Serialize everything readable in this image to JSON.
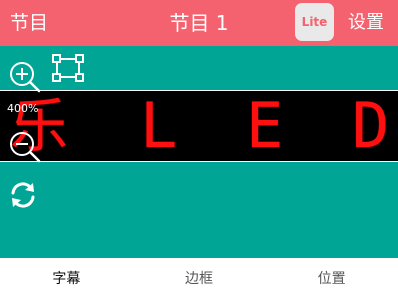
{
  "header": {
    "left_label": "节目",
    "title": "节目 1",
    "lite_label": "Lite",
    "settings_label": "设置"
  },
  "stage": {
    "zoom_level": "400%",
    "led_glyphs": [
      "乐",
      "L",
      "E",
      "D"
    ]
  },
  "tabs": [
    {
      "label": "字幕",
      "active": true
    },
    {
      "label": "边框",
      "active": false
    },
    {
      "label": "位置",
      "active": false
    }
  ],
  "colors": {
    "header": "#f4616f",
    "stage": "#00a596",
    "led_text": "#ff1010",
    "lite_bg": "#e9e9e9"
  },
  "icons": [
    "zoom-in-icon",
    "select-frame-icon",
    "zoom-out-icon",
    "refresh-icon"
  ]
}
